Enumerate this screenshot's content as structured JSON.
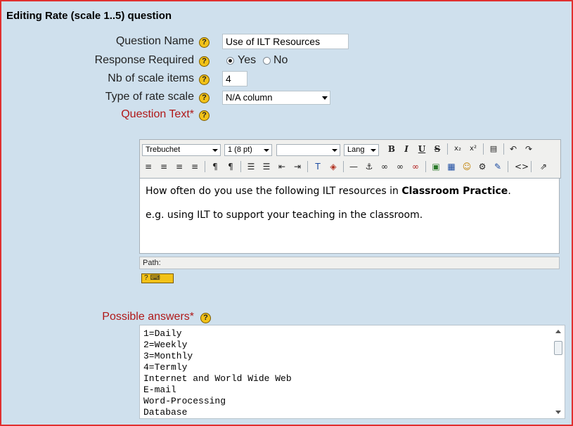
{
  "page_title": "Editing Rate (scale 1..5) question",
  "fields": {
    "question_name": {
      "label": "Question Name",
      "value": "Use of ILT Resources"
    },
    "response_required": {
      "label": "Response Required",
      "yes": "Yes",
      "no": "No",
      "selected": "Yes"
    },
    "nb_scale_items": {
      "label": "Nb of scale items",
      "value": "4"
    },
    "type_rate_scale": {
      "label": "Type of rate scale",
      "value": "N/A column"
    },
    "question_text": {
      "label": "Question Text*"
    },
    "possible_answers": {
      "label": "Possible answers*"
    }
  },
  "help_glyph": "?",
  "editor": {
    "font": "Trebuchet",
    "size": "1 (8 pt)",
    "style": "",
    "lang": "Lang",
    "buttons": {
      "bold": "B",
      "italic": "I",
      "underline": "U",
      "strike": "S"
    },
    "content": {
      "line1_pre": "How often do you use the following ILT resources in ",
      "line1_bold": "Classroom Practice",
      "line1_post": ".",
      "line2": "e.g. using ILT to support your teaching in the classroom."
    },
    "path_label": "Path:"
  },
  "answers": [
    "1=Daily",
    "2=Weekly",
    "3=Monthly",
    "4=Termly",
    "Internet and World Wide Web",
    "E-mail",
    "Word-Processing",
    "Database"
  ]
}
